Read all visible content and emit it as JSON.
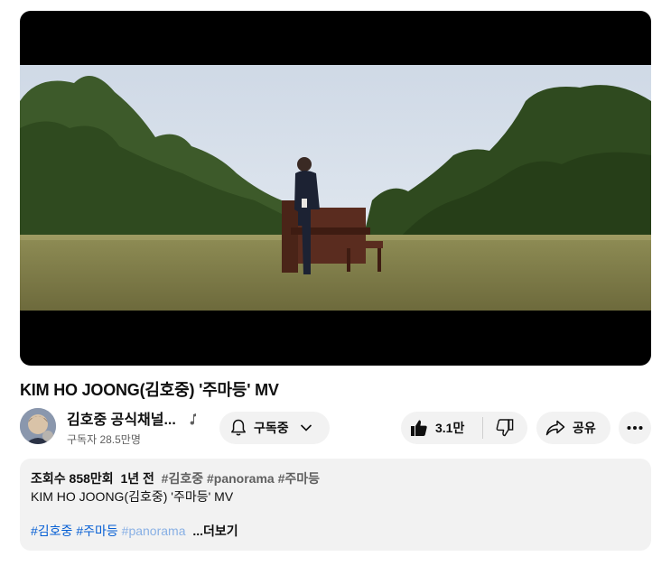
{
  "video": {
    "title": "KIM HO JOONG(김호중) '주마등' MV"
  },
  "channel": {
    "name": "김호중 공식채널...",
    "subscribers": "구독자 28.5만명",
    "avatar_icon": "avatar-icon"
  },
  "actions": {
    "subscribe_label": "구독중",
    "like_count": "3.1만",
    "share_label": "공유"
  },
  "description": {
    "views": "조회수 858만회",
    "age": "1년 전",
    "top_tags": [
      "#김호중",
      "#panorama",
      "#주마등"
    ],
    "text": "KIM HO JOONG(김호중) '주마등' MV",
    "hashtags": [
      "#김호중",
      "#주마등"
    ],
    "hashtag_faded": "#panorama",
    "more_label": "...더보기"
  },
  "colors": {
    "link": "#065fd4",
    "pill_bg": "#f2f2f2",
    "player_bg": "#000000"
  }
}
